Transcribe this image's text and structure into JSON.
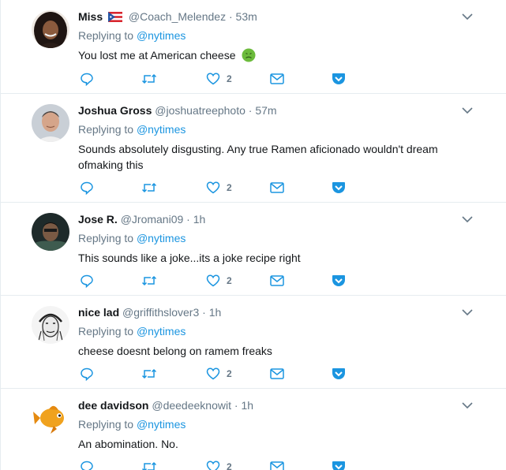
{
  "tweets": [
    {
      "fullname": "Miss",
      "username": "@Coach_Melendez",
      "time": "53m",
      "reply_prefix": "Replying to",
      "reply_to": "@nytimes",
      "text": "You lost me at American cheese",
      "like_count": "2",
      "avatar": "avatar-woman-dark-hair",
      "flag": "puerto-rico-flag-icon",
      "emoji": "nauseated-face-emoji"
    },
    {
      "fullname": "Joshua Gross",
      "username": "@joshuatreephoto",
      "time": "57m",
      "reply_prefix": "Replying to",
      "reply_to": "@nytimes",
      "text": "Sounds absolutely disgusting. Any true Ramen aficionado wouldn't dream ofmaking this",
      "like_count": "2",
      "avatar": "avatar-man-gray-hair"
    },
    {
      "fullname": "Jose R.",
      "username": "@Jromani09",
      "time": "1h",
      "reply_prefix": "Replying to",
      "reply_to": "@nytimes",
      "text": "This sounds like a joke...its a joke recipe right",
      "like_count": "2",
      "avatar": "avatar-man-dark-photo"
    },
    {
      "fullname": "nice lad",
      "username": "@griffithslover3",
      "time": "1h",
      "reply_prefix": "Replying to",
      "reply_to": "@nytimes",
      "text": "cheese doesnt belong on ramem freaks",
      "like_count": "2",
      "avatar": "avatar-sketch-old-man"
    },
    {
      "fullname": "dee davidson",
      "username": "@deedeeknowit",
      "time": "1h",
      "reply_prefix": "Replying to",
      "reply_to": "@nytimes",
      "text": "An abomination. No.",
      "like_count": "2",
      "avatar": "avatar-orange-fish"
    }
  ],
  "separator": "·",
  "colors": {
    "text": "#14171a",
    "secondary": "#657786",
    "link": "#1b95e0",
    "divider": "#e6ecf0",
    "icon": "#657786",
    "action_icon": "#1da1f2"
  }
}
